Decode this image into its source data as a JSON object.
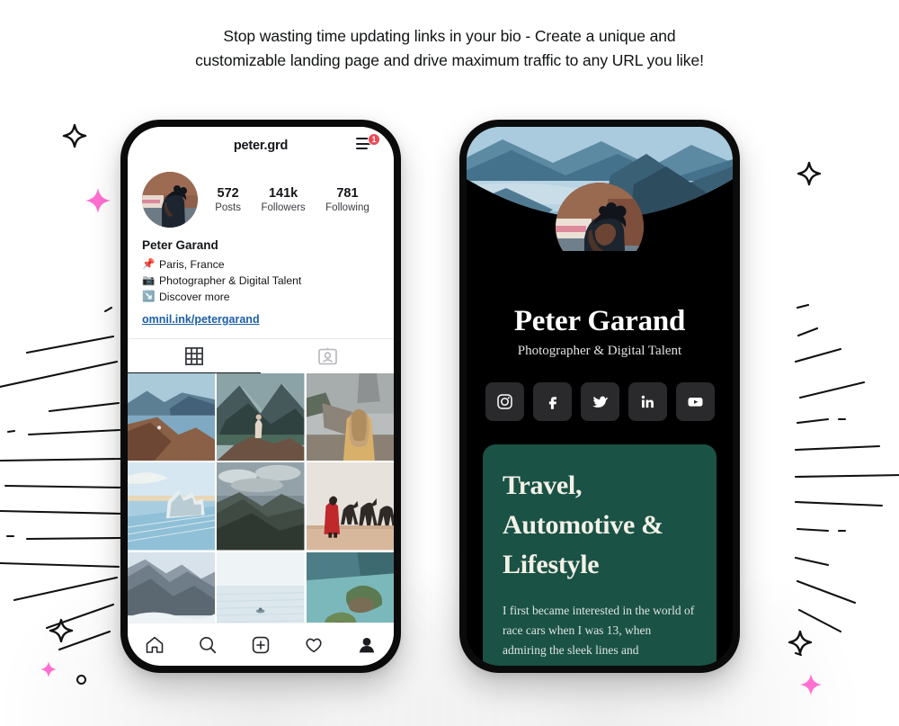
{
  "headline": {
    "line1": "Stop wasting time updating links in your bio - Create a unique and",
    "line2": "customizable landing page and drive maximum traffic to any URL you like!"
  },
  "instagram_phone": {
    "handle": "peter.grd",
    "menu_badge": "1",
    "stats": [
      {
        "value": "572",
        "label": "Posts"
      },
      {
        "value": "141k",
        "label": "Followers"
      },
      {
        "value": "781",
        "label": "Following"
      }
    ],
    "profile": {
      "name": "Peter Garand",
      "bio_lines": [
        {
          "emoji": "📌",
          "text": "Paris, France"
        },
        {
          "emoji": "📷",
          "text": "Photographer & Digital Talent"
        },
        {
          "emoji": "↘️",
          "text": "Discover more"
        }
      ],
      "link": "omnil.ink/petergarand"
    },
    "tabs": [
      {
        "name": "grid-tab",
        "active": true
      },
      {
        "name": "tagged-tab",
        "active": false
      }
    ],
    "grid_photos": [
      "mountain-ridge-over-fjord",
      "woman-standing-on-rock-over-lake",
      "blonde-woman-in-fog-at-castle",
      "icy-shipwreck-at-sunrise",
      "dark-mountain-range-with-clouds",
      "red-robed-figure-with-camels",
      "cliff-face-above-clouds",
      "lone-swimmer-in-pale-sea",
      "rocky-islet-in-turquoise-bay"
    ],
    "bottom_nav": [
      "home-icon",
      "search-icon",
      "add-post-icon",
      "activity-heart-icon",
      "profile-icon"
    ]
  },
  "landing_phone": {
    "hero_image": "mountain-lake-panorama",
    "avatar_image": "portrait-of-peter-garand",
    "name": "Peter Garand",
    "tagline": "Photographer & Digital Talent",
    "socials": [
      "instagram-icon",
      "facebook-icon",
      "twitter-icon",
      "linkedin-icon",
      "youtube-icon"
    ],
    "card": {
      "heading": "Travel, Automotive & Lifestyle",
      "body": "I first became interested in the world of race cars when I was 13, when admiring the sleek lines and"
    }
  },
  "decorations": {
    "star_outline": "four-point-star-outline",
    "star_filled": "four-point-star-filled",
    "circle_outline": "small-circle-outline",
    "sunburst": "hand-drawn-radiating-lines"
  },
  "colors": {
    "page_bg": "#ffffff",
    "phone_frame": "#0b0b0c",
    "card_green": "#1a5245",
    "link_blue": "#1c5fa8",
    "badge_red": "#ed4956",
    "star_pink": "#ff6fd0",
    "ink": "#111315"
  }
}
